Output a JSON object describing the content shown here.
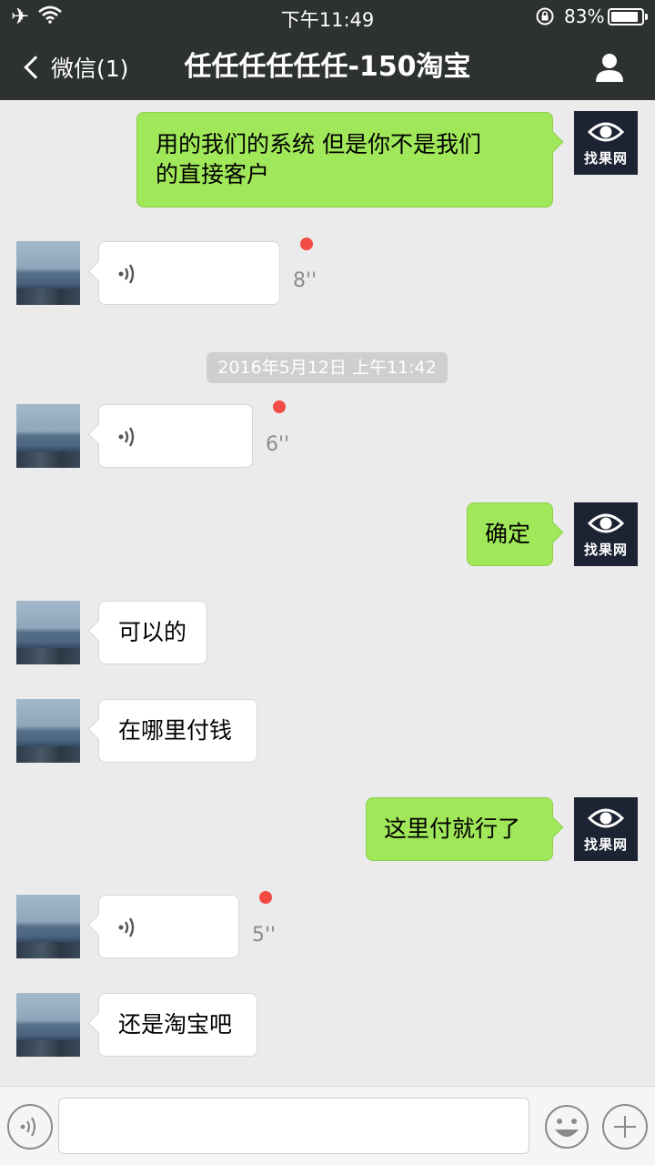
{
  "status_bar": {
    "time": "下午11:49",
    "battery_percent": "83%",
    "battery_level": 0.83
  },
  "nav": {
    "back_label": "微信(1)",
    "title": "任任任任任任-150淘宝"
  },
  "self_avatar_text": "找果网",
  "timestamp": "2016年5月12日 上午11:42",
  "messages": [
    {
      "side": "right",
      "type": "text",
      "text_line1": "用的我们的系统   但是你不是我们",
      "text_line2": "的直接客户"
    },
    {
      "side": "left",
      "type": "voice",
      "duration": "8''",
      "unread": true
    },
    {
      "side": "left",
      "type": "voice",
      "duration": "6''",
      "unread": true
    },
    {
      "side": "right",
      "type": "text",
      "text": "确定"
    },
    {
      "side": "left",
      "type": "text",
      "text": "可以的"
    },
    {
      "side": "left",
      "type": "text",
      "text": "在哪里付钱"
    },
    {
      "side": "right",
      "type": "text",
      "text": "这里付就行了"
    },
    {
      "side": "left",
      "type": "voice",
      "duration": "5''",
      "unread": true
    },
    {
      "side": "left",
      "type": "text",
      "text": "还是淘宝吧"
    }
  ],
  "colors": {
    "header_bg": "#2e3132",
    "chat_bg": "#ebebeb",
    "green_bubble": "#a0e759",
    "unread_dot": "#f24b44"
  },
  "icons": {
    "status_left": [
      "airplane-icon",
      "wifi-icon"
    ],
    "status_right": [
      "rotation-lock-icon",
      "battery-icon"
    ],
    "nav": [
      "chevron-left-icon",
      "user-icon"
    ],
    "input_bar": [
      "voice-icon",
      "emoji-icon",
      "plus-icon"
    ]
  },
  "input_bar": {
    "text_value": ""
  }
}
